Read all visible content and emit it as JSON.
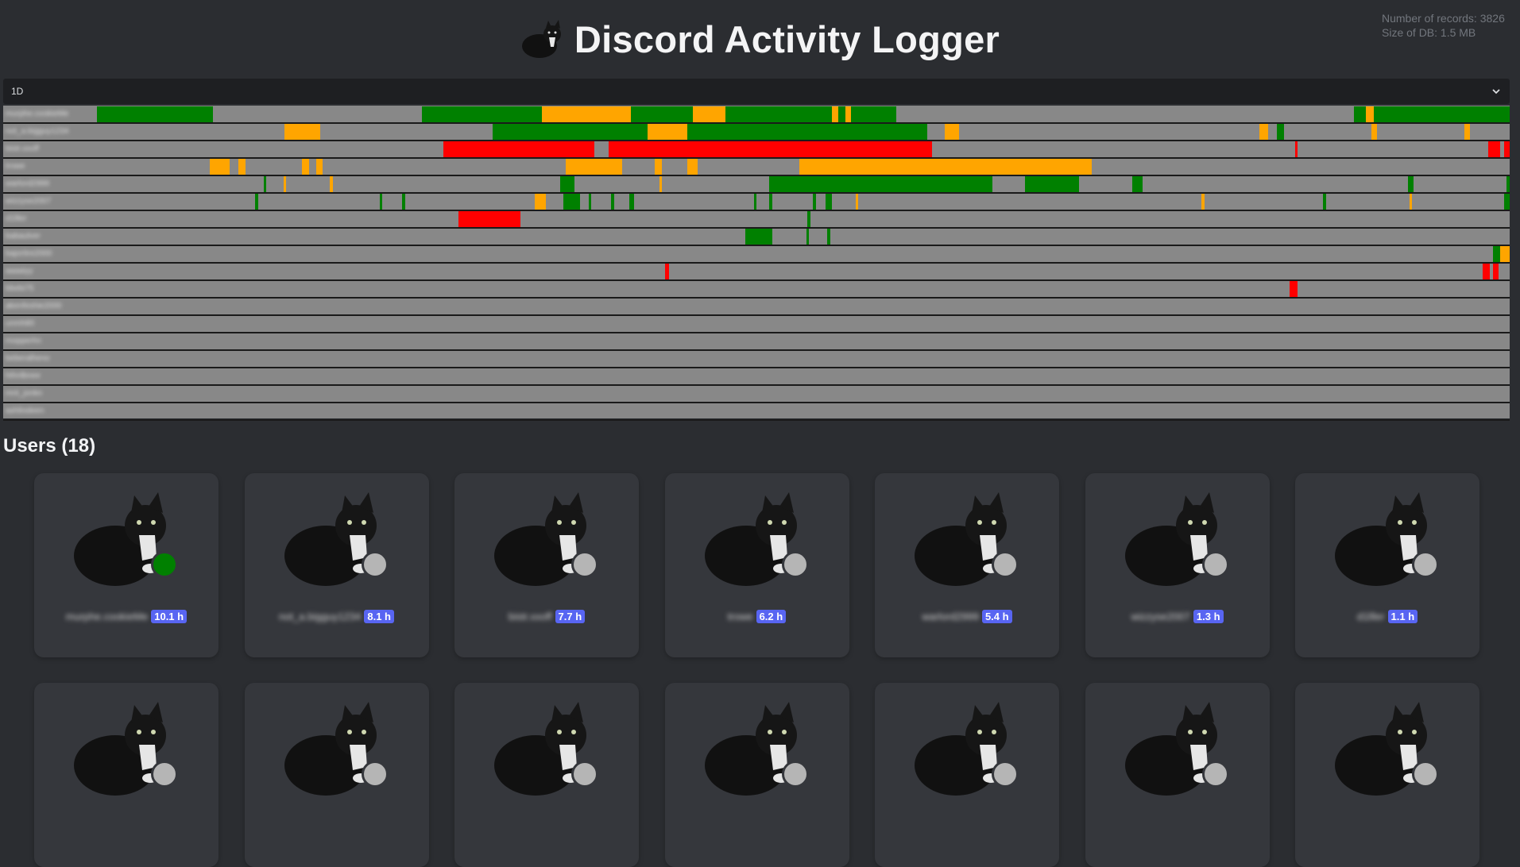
{
  "app": {
    "title": "Discord Activity Logger",
    "stats_records": "Number of records: 3826",
    "stats_size": "Size of DB: 1.5 MB"
  },
  "timeline": {
    "range": "1D",
    "colors": {
      "online": "#008000",
      "idle": "#ffa500",
      "dnd": "#ff0000",
      "offline": "#888888"
    },
    "rows": [
      {
        "label": "murphe.cookieMe",
        "segments": [
          {
            "s": 0,
            "e": 0.082,
            "t": "online"
          },
          {
            "s": 0.23,
            "e": 0.315,
            "t": "online"
          },
          {
            "s": 0.315,
            "e": 0.378,
            "t": "idle"
          },
          {
            "s": 0.378,
            "e": 0.41,
            "t": "online"
          },
          {
            "s": 0.41,
            "e": 0.422,
            "t": "online"
          },
          {
            "s": 0.422,
            "e": 0.445,
            "t": "idle"
          },
          {
            "s": 0.445,
            "e": 0.52,
            "t": "online"
          },
          {
            "s": 0.52,
            "e": 0.525,
            "t": "idle"
          },
          {
            "s": 0.525,
            "e": 0.53,
            "t": "online"
          },
          {
            "s": 0.53,
            "e": 0.534,
            "t": "idle"
          },
          {
            "s": 0.534,
            "e": 0.566,
            "t": "online"
          },
          {
            "s": 0.89,
            "e": 0.898,
            "t": "online"
          },
          {
            "s": 0.898,
            "e": 0.904,
            "t": "idle"
          },
          {
            "s": 0.904,
            "e": 1,
            "t": "online"
          }
        ]
      },
      {
        "label": "not_a.bigguy1234",
        "segments": [
          {
            "s": 0.133,
            "e": 0.141,
            "t": "idle"
          },
          {
            "s": 0.141,
            "e": 0.158,
            "t": "idle"
          },
          {
            "s": 0.28,
            "e": 0.39,
            "t": "online"
          },
          {
            "s": 0.39,
            "e": 0.418,
            "t": "idle"
          },
          {
            "s": 0.418,
            "e": 0.588,
            "t": "online"
          },
          {
            "s": 0.6,
            "e": 0.61,
            "t": "idle"
          },
          {
            "s": 0.823,
            "e": 0.829,
            "t": "idle"
          },
          {
            "s": 0.835,
            "e": 0.84,
            "t": "online"
          },
          {
            "s": 0.902,
            "e": 0.906,
            "t": "idle"
          },
          {
            "s": 0.968,
            "e": 0.972,
            "t": "idle"
          }
        ]
      },
      {
        "label": "bistr.xxoff",
        "segments": [
          {
            "s": 0.245,
            "e": 0.352,
            "t": "dnd"
          },
          {
            "s": 0.362,
            "e": 0.591,
            "t": "dnd"
          },
          {
            "s": 0.848,
            "e": 0.85,
            "t": "dnd"
          },
          {
            "s": 0.985,
            "e": 0.993,
            "t": "dnd"
          },
          {
            "s": 0.996,
            "e": 1,
            "t": "dnd"
          }
        ]
      },
      {
        "label": "trowe",
        "segments": [
          {
            "s": 0.08,
            "e": 0.094,
            "t": "idle"
          },
          {
            "s": 0.1,
            "e": 0.105,
            "t": "idle"
          },
          {
            "s": 0.145,
            "e": 0.15,
            "t": "idle"
          },
          {
            "s": 0.155,
            "e": 0.16,
            "t": "idle"
          },
          {
            "s": 0.332,
            "e": 0.345,
            "t": "idle"
          },
          {
            "s": 0.345,
            "e": 0.362,
            "t": "idle"
          },
          {
            "s": 0.362,
            "e": 0.372,
            "t": "idle"
          },
          {
            "s": 0.395,
            "e": 0.4,
            "t": "idle"
          },
          {
            "s": 0.418,
            "e": 0.425,
            "t": "idle"
          },
          {
            "s": 0.497,
            "e": 0.704,
            "t": "idle"
          }
        ]
      },
      {
        "label": "warlord2999",
        "segments": [
          {
            "s": 0.118,
            "e": 0.12,
            "t": "online"
          },
          {
            "s": 0.132,
            "e": 0.134,
            "t": "idle"
          },
          {
            "s": 0.165,
            "e": 0.167,
            "t": "idle"
          },
          {
            "s": 0.328,
            "e": 0.338,
            "t": "online"
          },
          {
            "s": 0.398,
            "e": 0.4,
            "t": "idle"
          },
          {
            "s": 0.476,
            "e": 0.634,
            "t": "online"
          },
          {
            "s": 0.657,
            "e": 0.695,
            "t": "online"
          },
          {
            "s": 0.733,
            "e": 0.74,
            "t": "online"
          },
          {
            "s": 0.928,
            "e": 0.932,
            "t": "online"
          },
          {
            "s": 0.998,
            "e": 1,
            "t": "online"
          }
        ]
      },
      {
        "label": "wizzyse2007",
        "segments": [
          {
            "s": 0.112,
            "e": 0.114,
            "t": "online"
          },
          {
            "s": 0.2,
            "e": 0.202,
            "t": "online"
          },
          {
            "s": 0.216,
            "e": 0.218,
            "t": "online"
          },
          {
            "s": 0.31,
            "e": 0.318,
            "t": "idle"
          },
          {
            "s": 0.33,
            "e": 0.342,
            "t": "online"
          },
          {
            "s": 0.348,
            "e": 0.35,
            "t": "online"
          },
          {
            "s": 0.364,
            "e": 0.366,
            "t": "online"
          },
          {
            "s": 0.377,
            "e": 0.38,
            "t": "online"
          },
          {
            "s": 0.465,
            "e": 0.467,
            "t": "online"
          },
          {
            "s": 0.476,
            "e": 0.478,
            "t": "online"
          },
          {
            "s": 0.507,
            "e": 0.509,
            "t": "online"
          },
          {
            "s": 0.516,
            "e": 0.52,
            "t": "online"
          },
          {
            "s": 0.537,
            "e": 0.539,
            "t": "idle"
          },
          {
            "s": 0.782,
            "e": 0.784,
            "t": "idle"
          },
          {
            "s": 0.868,
            "e": 0.87,
            "t": "online"
          },
          {
            "s": 0.929,
            "e": 0.931,
            "t": "idle"
          },
          {
            "s": 0.996,
            "e": 1,
            "t": "online"
          }
        ]
      },
      {
        "label": "d1lller",
        "segments": [
          {
            "s": 0.256,
            "e": 0.3,
            "t": "dnd"
          },
          {
            "s": 0.503,
            "e": 0.505,
            "t": "online"
          }
        ]
      },
      {
        "label": "babaulver",
        "segments": [
          {
            "s": 0.459,
            "e": 0.478,
            "t": "online"
          },
          {
            "s": 0.502,
            "e": 0.504,
            "t": "online"
          },
          {
            "s": 0.517,
            "e": 0.519,
            "t": "online"
          }
        ]
      },
      {
        "label": "bajoritre2000",
        "segments": [
          {
            "s": 0.988,
            "e": 0.993,
            "t": "online"
          },
          {
            "s": 0.993,
            "e": 1,
            "t": "idle"
          }
        ]
      },
      {
        "label": "aaaaiyy",
        "segments": [
          {
            "s": 0.402,
            "e": 0.405,
            "t": "dnd"
          },
          {
            "s": 0.981,
            "e": 0.986,
            "t": "dnd"
          },
          {
            "s": 0.988,
            "e": 0.992,
            "t": "dnd"
          }
        ]
      },
      {
        "label": "bbebi75",
        "segments": [
          {
            "s": 0.844,
            "e": 0.85,
            "t": "dnd"
          }
        ]
      },
      {
        "label": "akenfeshie2000",
        "segments": []
      },
      {
        "label": "unmh80",
        "segments": []
      },
      {
        "label": "mopperhn",
        "segments": []
      },
      {
        "label": "beberalheno",
        "segments": []
      },
      {
        "label": "hthnlbnee",
        "segments": []
      },
      {
        "label": "mnt_jonkn",
        "segments": []
      },
      {
        "label": "ashlindeen",
        "segments": []
      }
    ]
  },
  "users": {
    "heading": "Users (18)",
    "cards": [
      {
        "name": "murphe.cookieMe",
        "hours": "10.1 h",
        "status_color": "#008000"
      },
      {
        "name": "not_a.bigguy1234",
        "hours": "8.1 h",
        "status_color": "#b5b5b5"
      },
      {
        "name": "bistr.xxoff",
        "hours": "7.7 h",
        "status_color": "#b5b5b5"
      },
      {
        "name": "trowe",
        "hours": "6.2 h",
        "status_color": "#b5b5b5"
      },
      {
        "name": "warlord2999",
        "hours": "5.4 h",
        "status_color": "#b5b5b5"
      },
      {
        "name": "wizzyse2007",
        "hours": "1.3 h",
        "status_color": "#b5b5b5"
      },
      {
        "name": "d1lller",
        "hours": "1.1 h",
        "status_color": "#b5b5b5"
      },
      {
        "name": "",
        "hours": "",
        "status_color": "#b5b5b5"
      },
      {
        "name": "",
        "hours": "",
        "status_color": "#b5b5b5"
      },
      {
        "name": "",
        "hours": "",
        "status_color": "#b5b5b5"
      },
      {
        "name": "",
        "hours": "",
        "status_color": "#b5b5b5"
      },
      {
        "name": "",
        "hours": "",
        "status_color": "#b5b5b5"
      },
      {
        "name": "",
        "hours": "",
        "status_color": "#b5b5b5"
      },
      {
        "name": "",
        "hours": "",
        "status_color": "#b5b5b5"
      }
    ]
  }
}
